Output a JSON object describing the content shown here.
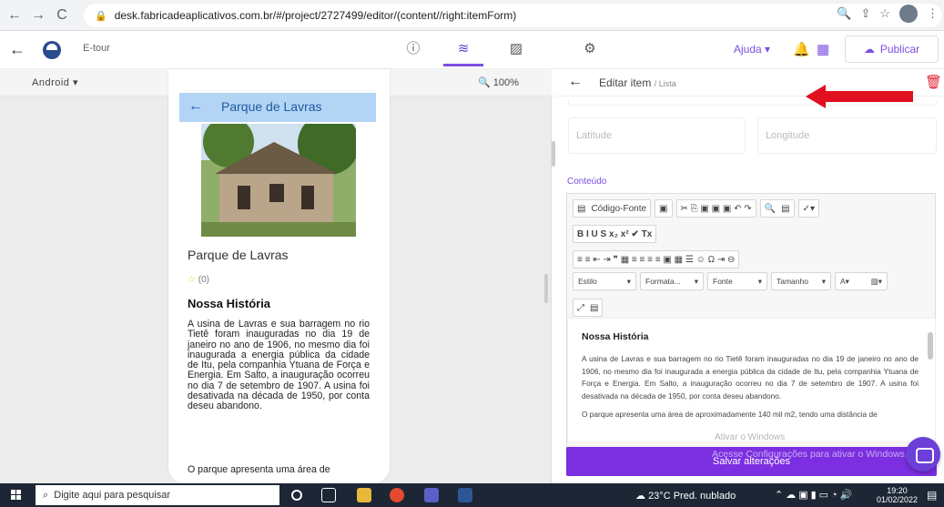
{
  "browser": {
    "url": "desk.fabricadeaplicativos.com.br/#/project/2727499/editor/(content//right:itemForm)",
    "nav": {
      "back": "←",
      "forward": "→",
      "reload": "C"
    }
  },
  "app": {
    "name": "E-tour",
    "ajuda_label": "Ajuda",
    "publicar_label": "Publicar"
  },
  "preview": {
    "platform": "Android",
    "zoom": "100%",
    "screen_title": "Parque de Lavras",
    "place_name": "Parque de Lavras",
    "rating": "(0)",
    "section_title": "Nossa História",
    "body": "A usina de Lavras e sua barragem no rio Tietê foram inauguradas no dia 19 de janeiro no ano de 1906, no mesmo dia foi inaugurada a energia pública da cidade de Itu, pela companhia Ytuana de Força e Energia. Em Salto, a inauguração ocorreu no dia 7 de setembro de 1907. A usina foi desativada na década de 1950, por conta deseu abandono.",
    "body2": "O parque apresenta uma área de"
  },
  "form": {
    "title": "Editar item",
    "subtitle": "/ Lista",
    "latitude_placeholder": "Latitude",
    "longitude_placeholder": "Longitude",
    "content_label": "Conteúdo",
    "toolbar": {
      "source_label": "Código-Fonte",
      "style_label": "Estilo",
      "format_label": "Formata...",
      "font_label": "Fonte",
      "size_label": "Tamanho",
      "row1_icons": "✂ ⎘ ▣ ▣ ▣ ↶ ↷",
      "row2_icons": "B  I  U  S  x₂  x²  ✔  Tx",
      "row3_icons": "≡ ≡ ⇤ ⇥ ❞ ▦ ≡ ≡ ≡ ≡ ▣ ▦ ☰ ☺ Ω ⇥ ⊖"
    },
    "editor_heading": "Nossa História",
    "editor_body": "A usina de Lavras e sua barragem no rio Tietê foram inauguradas no dia 19 de janeiro no ano de 1906, no mesmo dia foi inaugurada a energia pública da cidade de Itu, pela companhia Ytuana de Força e Energia. Em Salto, a inauguração ocorreu no dia 7 de setembro de 1907. A usina foi desativada na década de 1950, por conta deseu abandono.",
    "editor_body2": "O parque apresenta uma área de aproximadamente 140 mil m2, tendo uma distância de",
    "save_label": "Salvar alterações"
  },
  "watermark": {
    "line1": "Ativar o Windows",
    "line2": "Acesse Configurações para ativar o Windows."
  },
  "taskbar": {
    "search_placeholder": "Digite aqui para pesquisar",
    "weather": "23°C  Pred. nublado",
    "time": "19:20",
    "date": "01/02/2022"
  },
  "colors": {
    "accent": "#7b2fe0",
    "header_bar": "#b3d4f5",
    "arrow": "#e0101e"
  }
}
